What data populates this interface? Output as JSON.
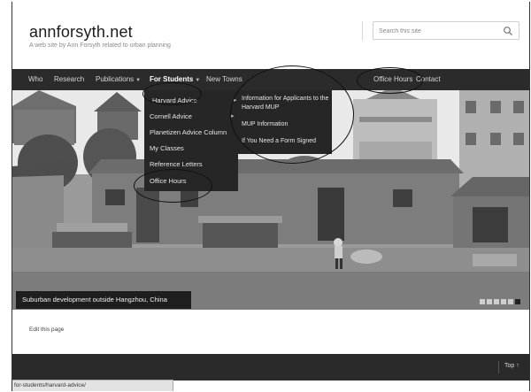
{
  "header": {
    "site_title": "annforsyth.net",
    "tagline": "A web site by Ann Forsyth related to urban planning",
    "search_placeholder": "Search this site"
  },
  "nav": {
    "items": [
      {
        "label": "Who"
      },
      {
        "label": "Research"
      },
      {
        "label": "Publications"
      },
      {
        "label": "For Students"
      },
      {
        "label": "New Towns"
      },
      {
        "label": "Office Hours"
      },
      {
        "label": "Contact"
      }
    ]
  },
  "dropdown": {
    "items": [
      {
        "label": "Harvard Advice"
      },
      {
        "label": "Cornell Advice"
      },
      {
        "label": "Planetizen Advice Column"
      },
      {
        "label": "My Classes"
      },
      {
        "label": "Reference Letters"
      },
      {
        "label": "Office Hours"
      }
    ]
  },
  "submenu": {
    "items": [
      {
        "label": "Information for Applicants to the Harvard MUP"
      },
      {
        "label": "MUP Information"
      },
      {
        "label": "If You Need a Form Signed"
      }
    ]
  },
  "hero": {
    "caption": "Suburban development outside Hangzhou, China",
    "slide_count": 6,
    "active_slide": 6
  },
  "page": {
    "edit_link": "Edit this page"
  },
  "footer": {
    "top_link": "Top ↑"
  },
  "status_bar": {
    "url": "for-students/harvard-advice/"
  }
}
